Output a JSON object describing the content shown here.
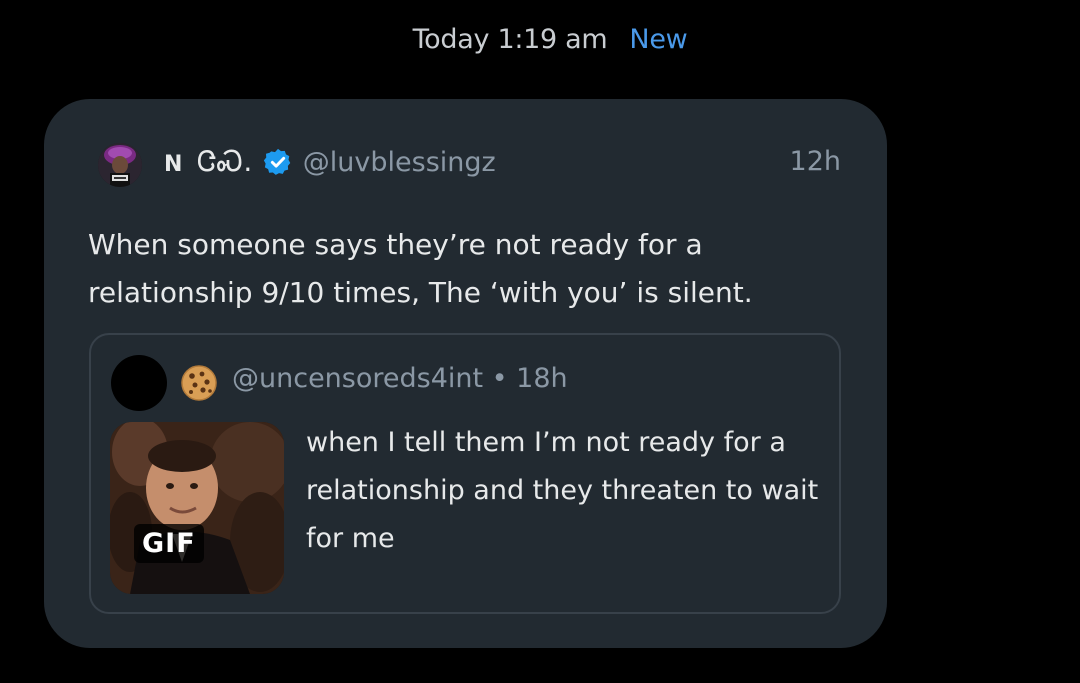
{
  "header": {
    "timestamp": "Today 1:19 am",
    "new_label": "New"
  },
  "tweet": {
    "display_name": "N",
    "display_name_suffix": "ᏣᏍ.",
    "verified": true,
    "handle": "@luvblessingz",
    "age": "12h",
    "text": "When someone says they’re not ready for a relationship 9/10 times, The ‘with you’ is silent."
  },
  "quoted_tweet": {
    "handle_line": "@uncensoreds4int • 18h",
    "media_badge": "GIF",
    "text": "when I tell them I’m not ready for a relationship and they threaten to wait for me"
  },
  "colors": {
    "background": "#000000",
    "bubble": "#222a31",
    "accent": "#4a99e9",
    "verified": "#1d9bf0",
    "muted_text": "#8b98a5",
    "primary_text": "#e7e9ea",
    "quote_border": "#38414a"
  },
  "icons": {
    "verified": "verified-badge-icon",
    "cookie": "cookie-emoji-icon"
  }
}
